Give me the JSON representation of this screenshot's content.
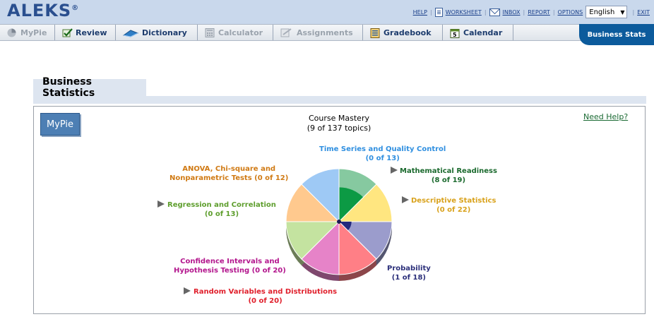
{
  "header": {
    "logo": "ALEKS",
    "logo_mark": "®",
    "links": {
      "help": "HELP",
      "worksheet": "WORKSHEET",
      "inbox": "INBOX",
      "report": "REPORT",
      "options": "OPTIONS",
      "exit": "EXIT"
    },
    "language": "English"
  },
  "tabs": {
    "mypie": "MyPie",
    "review": "Review",
    "dictionary": "Dictionary",
    "calculator": "Calculator",
    "assignments": "Assignments",
    "gradebook": "Gradebook",
    "calendar": "Calendar",
    "active": "Business Stats"
  },
  "section": {
    "title": "Business Statistics",
    "mypie_button": "MyPie",
    "need_help": "Need Help?",
    "mastery_title": "Course Mastery",
    "mastery_count": "(9 of 137 topics)"
  },
  "pie": {
    "total_topics": 137,
    "mastered_topics": 9,
    "slices": [
      {
        "name": "Mathematical Readiness",
        "count": "(8 of 19)",
        "mastered": 8,
        "total": 19,
        "color": "#86c9a0",
        "mastered_color": "#0c9a44",
        "text_color": "#1b6a2e"
      },
      {
        "name": "Descriptive Statistics",
        "count": "(0 of 22)",
        "mastered": 0,
        "total": 22,
        "color": "#ffe680",
        "mastered_color": "#f2c500",
        "text_color": "#d9a21c"
      },
      {
        "name": "Probability",
        "count": "(1 of 18)",
        "mastered": 1,
        "total": 18,
        "color": "#9b9ccc",
        "mastered_color": "#242a7d",
        "text_color": "#2b2f7a"
      },
      {
        "name": "Random Variables and Distributions",
        "count": "(0 of 20)",
        "mastered": 0,
        "total": 20,
        "color": "#ff7f86",
        "mastered_color": "#e0202c",
        "text_color": "#e0202c"
      },
      {
        "name": "Confidence Intervals and",
        "name2": "Hypothesis Testing (0 of 20)",
        "mastered": 0,
        "total": 20,
        "color": "#e683c8",
        "mastered_color": "#b6168a",
        "text_color": "#b3168d"
      },
      {
        "name": "Regression and Correlation",
        "count": "(0 of 13)",
        "mastered": 0,
        "total": 13,
        "color": "#c4e3a0",
        "mastered_color": "#6ea834",
        "text_color": "#5e9e2d"
      },
      {
        "name": "ANOVA, Chi-square and",
        "name2": "Nonparametric Tests (0 of 12)",
        "mastered": 0,
        "total": 12,
        "color": "#ffc98e",
        "mastered_color": "#e48a1c",
        "text_color": "#d07a14"
      },
      {
        "name": "Time Series and Quality Control",
        "count": "(0 of 13)",
        "mastered": 0,
        "total": 13,
        "color": "#9ec9f5",
        "mastered_color": "#2f8fe0",
        "text_color": "#2f8fe0"
      }
    ]
  }
}
